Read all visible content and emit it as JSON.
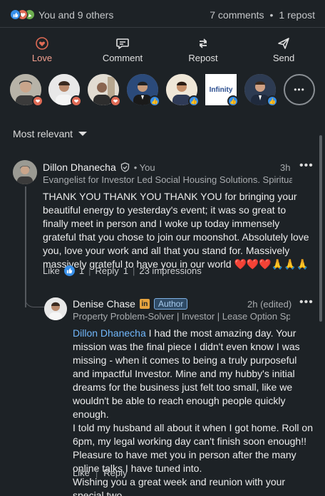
{
  "reactions": {
    "summary": "You and 9 others",
    "comments": "7 comments",
    "separator": "•",
    "reposts": "1 repost",
    "types": [
      "love-icon",
      "like-icon",
      "celebrate-icon"
    ],
    "colors": {
      "love": "#e06b55",
      "like": "#378fe9",
      "celebrate": "#6dae4f"
    }
  },
  "actions": [
    {
      "label": "Love",
      "icon": "heart-icon",
      "active": true
    },
    {
      "label": "Comment",
      "icon": "comment-icon"
    },
    {
      "label": "Repost",
      "icon": "repost-icon"
    },
    {
      "label": "Send",
      "icon": "send-icon"
    }
  ],
  "reactors": [
    {
      "badge": "love"
    },
    {
      "badge": "love"
    },
    {
      "badge": "love"
    },
    {
      "badge": "like"
    },
    {
      "badge": "like"
    },
    {
      "badge": "like",
      "logo_text": "Infinity"
    },
    {
      "badge": "like"
    }
  ],
  "more_reactors": "•••",
  "sort": {
    "label": "Most relevant"
  },
  "comment": {
    "name": "Dillon Dhanecha",
    "you": "• You",
    "headline": "Evangelist for Investor Led Social Housing Solutions. Spiritua...",
    "time": "3h",
    "menu": "•••",
    "text": "THANK YOU THANK YOU THANK YOU for bringing your beautiful energy to yesterday's event; it was so great to finally meet in person and I woke up today immensely grateful that you chose to join our moonshot. Absolutely love you, love your work and all that you stand for. Massively massively grateful to have you in our world ❤️❤️❤️🙏🙏🙏",
    "like_label": "Like",
    "like_count": "1",
    "reply_label": "Reply",
    "reply_count": "1",
    "impressions": "23 impressions",
    "separator": "|"
  },
  "reply": {
    "name": "Denise Chase",
    "li_badge": "in",
    "author_badge": "Author",
    "headline": "Property Problem-Solver | Investor | Lease Option Sp...",
    "time": "2h (edited)",
    "menu": "•••",
    "mention": "Dillon Dhanecha",
    "text_p1": " I had the most amazing day. Your mission was the final piece I didn't even know I was missing - when it comes to being a truly purposeful and impactful Investor. Mine and my hubby's initial dreams for the business just felt too small, like we wouldn't be able to reach enough people quickly enough.",
    "text_p2": "I told my husband all about it when I got home. Roll on 6pm, my legal working day can't finish soon enough!! Pleasure to have met you in person after the many online talks I have tuned into.",
    "text_p3": "Wishing you a great week and reunion with your special two.",
    "like_label": "Like",
    "reply_label": "Reply",
    "separator": "|"
  }
}
